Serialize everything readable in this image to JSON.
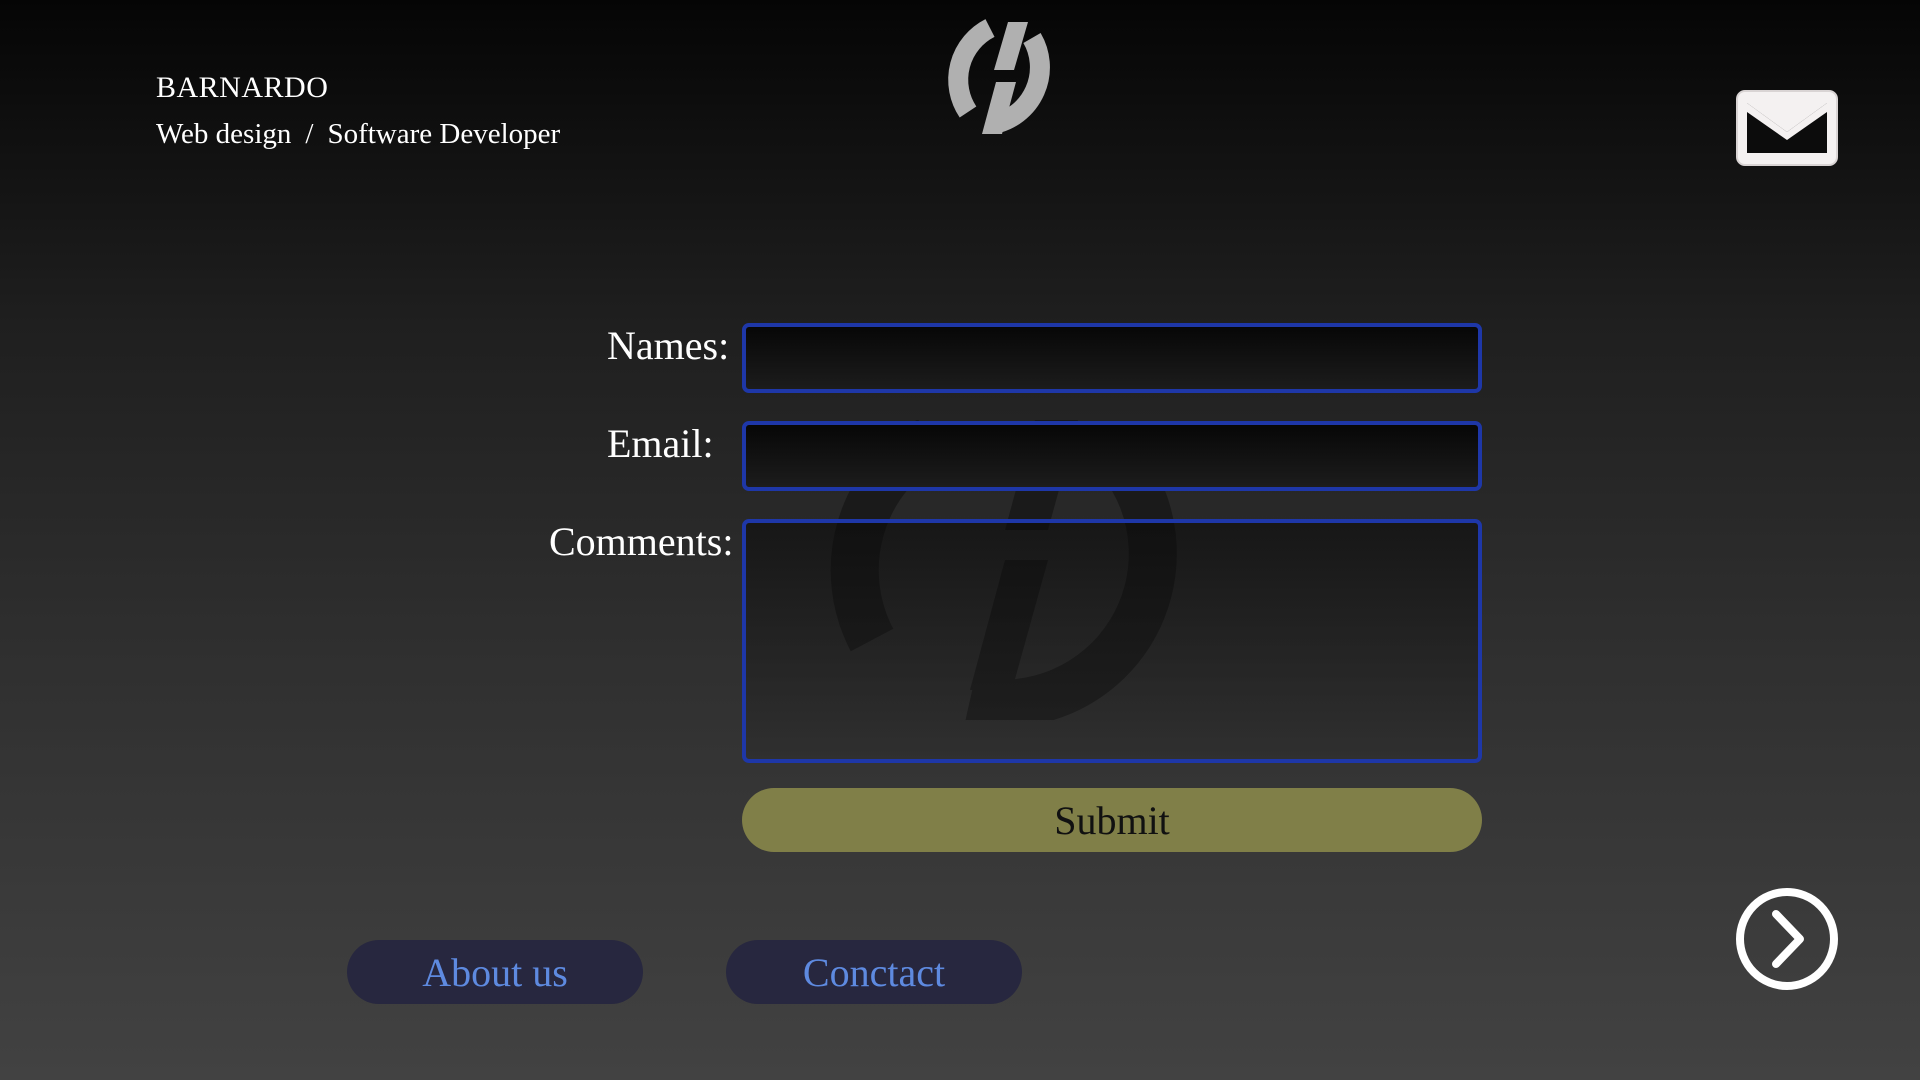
{
  "header": {
    "brand_name": "BARNARDO",
    "subtitle_left": "Web design",
    "subtitle_separator": "/",
    "subtitle_right": "Software Developer",
    "logo_icon": "power-swirl-logo-icon",
    "mail_icon": "envelope-icon"
  },
  "form": {
    "names_label": "Names:",
    "names_value": "",
    "email_label": "Email:",
    "email_value": "",
    "comments_label": "Comments:",
    "comments_value": "",
    "submit_label": "Submit"
  },
  "nav": {
    "about_label": "About us",
    "contact_label": "Conctact",
    "next_icon": "chevron-right-circle-icon"
  },
  "colors": {
    "field_border": "#1e37a8",
    "submit_bg": "#807f48",
    "nav_bg": "#27273f",
    "nav_text": "#5e8ae0",
    "logo": "#b0b0b0"
  }
}
